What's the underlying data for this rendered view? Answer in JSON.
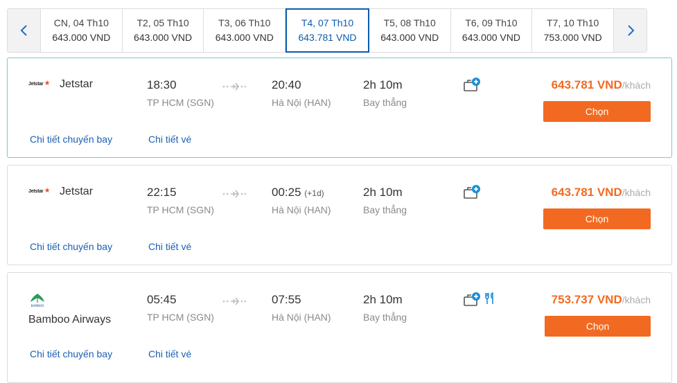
{
  "date_strip": {
    "prev_icon": "chevron-left-icon",
    "next_icon": "chevron-right-icon",
    "dates": [
      {
        "label": "CN, 04 Th10",
        "price": "643.000 VND",
        "active": false
      },
      {
        "label": "T2, 05 Th10",
        "price": "643.000 VND",
        "active": false
      },
      {
        "label": "T3, 06 Th10",
        "price": "643.000 VND",
        "active": false
      },
      {
        "label": "T4, 07 Th10",
        "price": "643.781 VND",
        "active": true
      },
      {
        "label": "T5, 08 Th10",
        "price": "643.000 VND",
        "active": false
      },
      {
        "label": "T6, 09 Th10",
        "price": "643.000 VND",
        "active": false
      },
      {
        "label": "T7, 10 Th10",
        "price": "753.000 VND",
        "active": false
      }
    ]
  },
  "flights": [
    {
      "airline": "Jetstar",
      "logo_text": "Jetstar",
      "dep_time": "18:30",
      "dep_airport": "TP HCM (SGN)",
      "arr_time": "20:40",
      "arr_plus": "",
      "arr_airport": "Hà Nội (HAN)",
      "duration": "2h 10m",
      "type": "Bay thẳng",
      "price": "643.781 VND",
      "per": "/khách",
      "button": "Chọn",
      "link_detail": "Chi tiết chuyến bay",
      "link_ticket": "Chi tiết vé"
    },
    {
      "airline": "Jetstar",
      "logo_text": "Jetstar",
      "dep_time": "22:15",
      "dep_airport": "TP HCM (SGN)",
      "arr_time": "00:25",
      "arr_plus": "(+1d)",
      "arr_airport": "Hà Nội (HAN)",
      "duration": "2h 10m",
      "type": "Bay thẳng",
      "price": "643.781 VND",
      "per": "/khách",
      "button": "Chọn",
      "link_detail": "Chi tiết chuyến bay",
      "link_ticket": "Chi tiết vé"
    },
    {
      "airline": "Bamboo Airways",
      "logo_text": "BAMBOO",
      "dep_time": "05:45",
      "dep_airport": "TP HCM (SGN)",
      "arr_time": "07:55",
      "arr_plus": "",
      "arr_airport": "Hà Nội (HAN)",
      "duration": "2h 10m",
      "type": "Bay thẳng",
      "price": "753.737 VND",
      "per": "/khách",
      "button": "Chọn",
      "link_detail": "Chi tiết chuyến bay",
      "link_ticket": "Chi tiết vé"
    }
  ],
  "colors": {
    "accent": "#f26a21",
    "active_date": "#0b5cad",
    "link": "#1a5fb4",
    "icon_blue": "#1a8fd6"
  }
}
